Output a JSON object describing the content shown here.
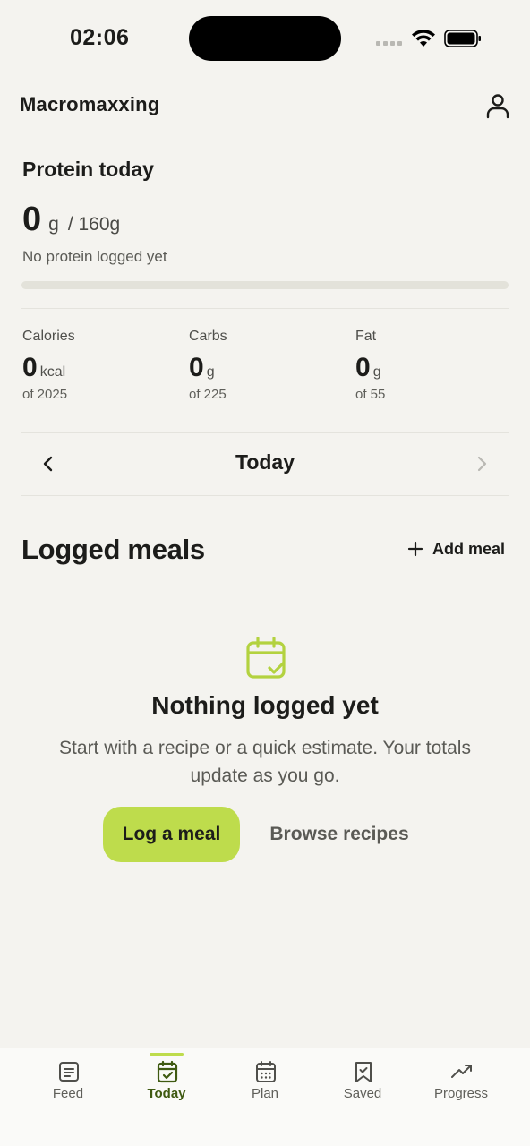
{
  "status_bar": {
    "time": "02:06"
  },
  "header": {
    "app_title": "Macromaxxing"
  },
  "protein": {
    "title": "Protein today",
    "value": "0",
    "unit": "g",
    "goal": "/ 160g",
    "status": "No protein logged yet",
    "progress_percent": 0
  },
  "macros": [
    {
      "label": "Calories",
      "value": "0",
      "unit": "kcal",
      "goal": "of 2025"
    },
    {
      "label": "Carbs",
      "value": "0",
      "unit": "g",
      "goal": "of 225"
    },
    {
      "label": "Fat",
      "value": "0",
      "unit": "g",
      "goal": "of 55"
    }
  ],
  "day_nav": {
    "label": "Today"
  },
  "meals": {
    "title": "Logged meals",
    "add_label": "Add meal"
  },
  "empty_state": {
    "icon": "calendar-check-icon",
    "title": "Nothing logged yet",
    "text": "Start with a recipe or a quick estimate. Your totals update as you go.",
    "primary_button": "Log a meal",
    "secondary_button": "Browse recipes"
  },
  "tabs": [
    {
      "label": "Feed",
      "icon": "feed-icon",
      "active": false
    },
    {
      "label": "Today",
      "icon": "calendar-check-icon",
      "active": true
    },
    {
      "label": "Plan",
      "icon": "calendar-icon",
      "active": false
    },
    {
      "label": "Saved",
      "icon": "bookmark-icon",
      "active": false
    },
    {
      "label": "Progress",
      "icon": "trend-up-icon",
      "active": false
    }
  ],
  "colors": {
    "background": "#f4f3ef",
    "accent": "#bedc4c",
    "active_tab": "#3f5a12",
    "text": "#1c1c1a"
  }
}
